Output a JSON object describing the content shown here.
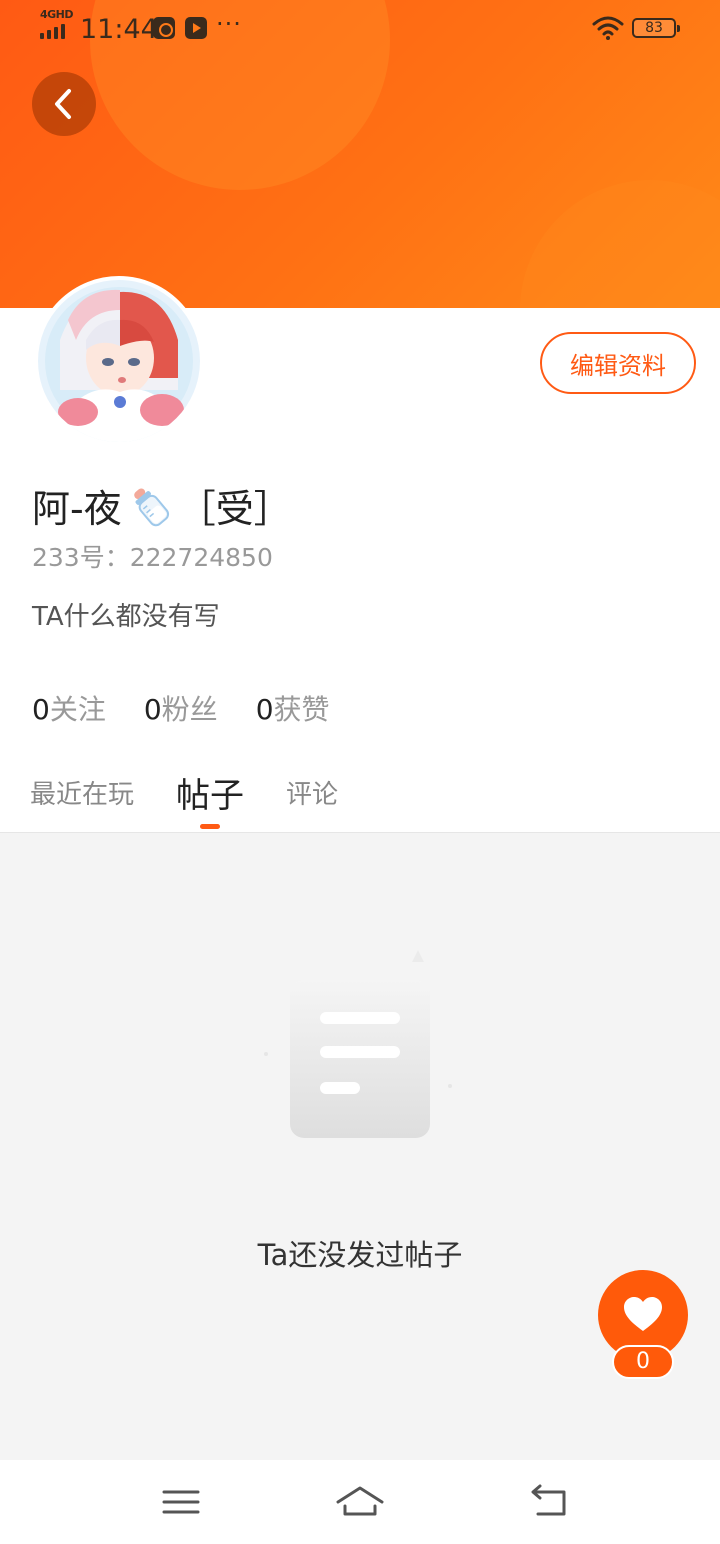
{
  "status_bar": {
    "network": "4GHD",
    "time": "11:44",
    "more": "···",
    "battery": "83"
  },
  "profile": {
    "nickname_part1": "阿-夜",
    "nickname_part2": "［受］",
    "uid": "233号：222724850",
    "bio": "TA什么都没有写",
    "edit_label": "编辑资料"
  },
  "stats": [
    {
      "num": "0",
      "label": "关注"
    },
    {
      "num": "0",
      "label": "粉丝"
    },
    {
      "num": "0",
      "label": "获赞"
    }
  ],
  "tabs": [
    {
      "label": "最近在玩",
      "active": false
    },
    {
      "label": "帖子",
      "active": true
    },
    {
      "label": "评论",
      "active": false
    }
  ],
  "empty": {
    "text": "Ta还没发过帖子"
  },
  "like": {
    "count": "0"
  },
  "colors": {
    "accent": "#ff5a14",
    "banner_start": "#ff5a14",
    "banner_end": "#ff8a18"
  },
  "icons": {
    "back": "chevron-left-icon",
    "like": "heart-icon",
    "menu": "menu-icon",
    "home": "home-icon",
    "return": "return-icon"
  }
}
